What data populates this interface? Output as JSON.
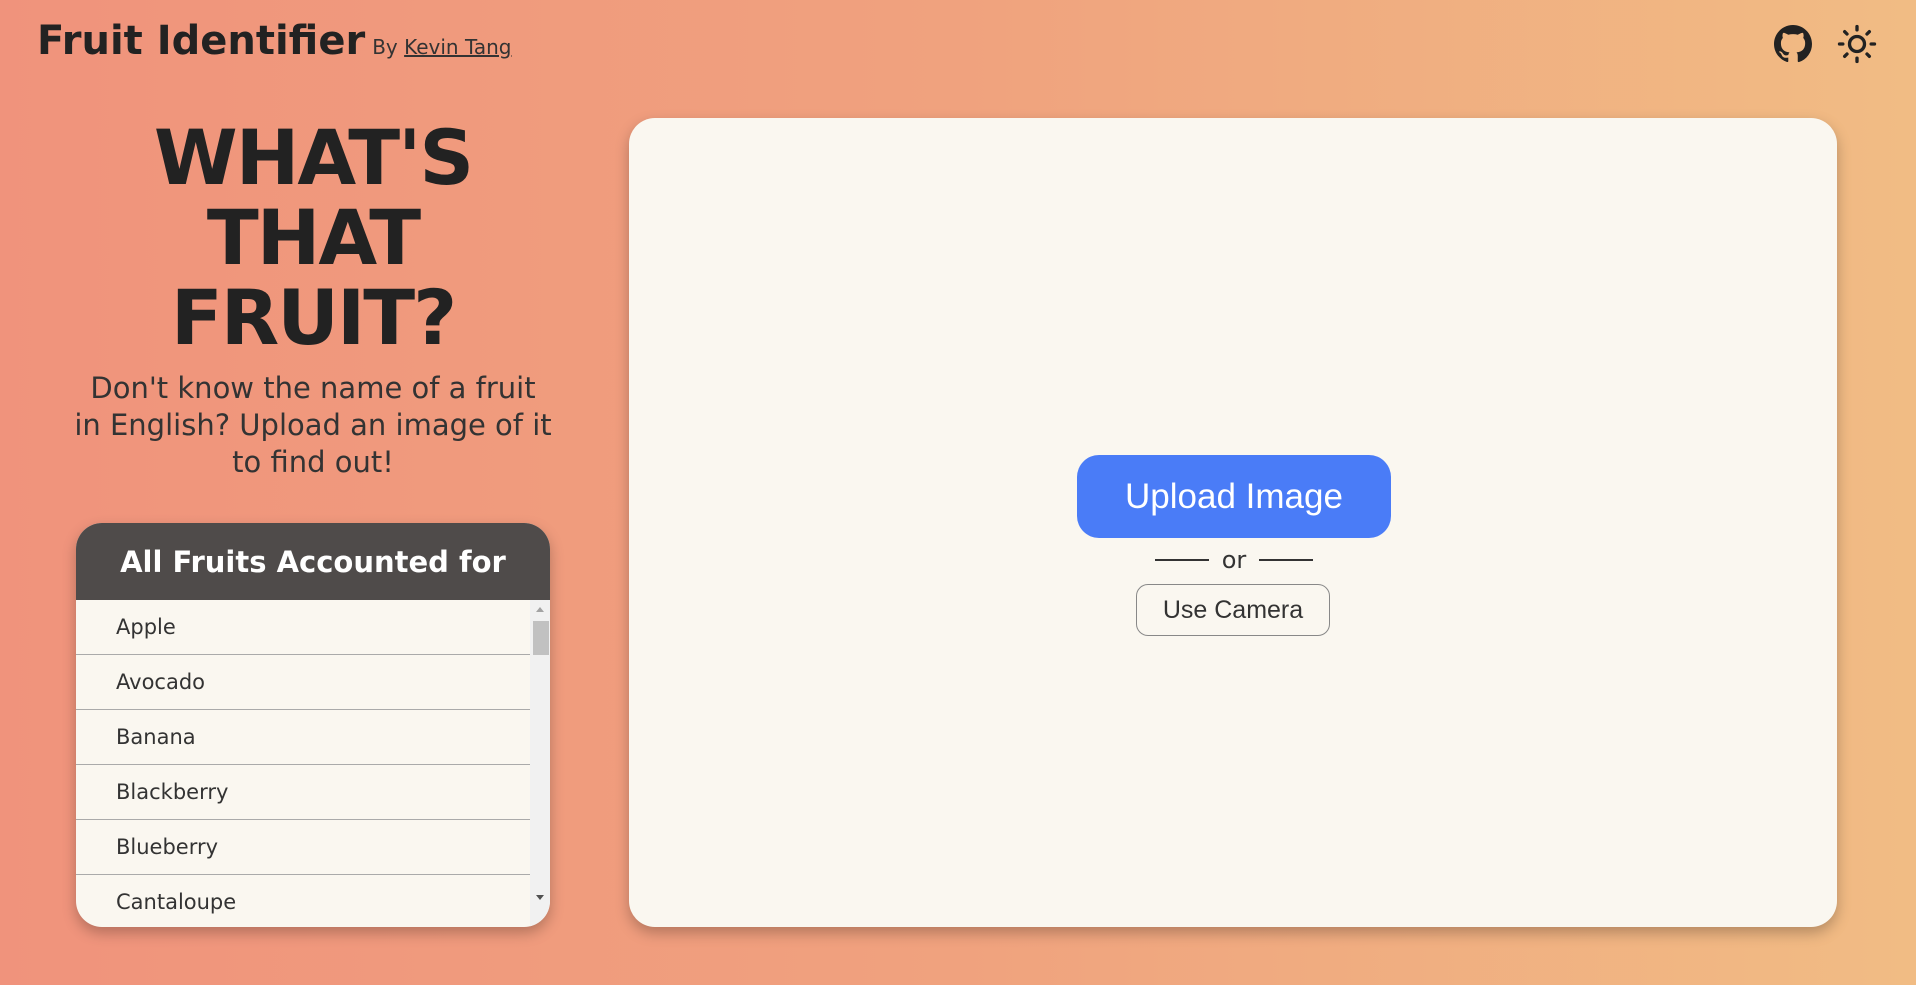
{
  "header": {
    "title": "Fruit Identifier",
    "by_label": "By",
    "author": "Kevin Tang",
    "icons": [
      "github-icon",
      "sun-icon"
    ]
  },
  "hero": {
    "line1": "WHAT'S",
    "line2": "THAT",
    "line3": "FRUIT?",
    "tagline": "Don't know the name of a fruit in English? Upload an image of it to find out!"
  },
  "fruit_list": {
    "heading": "All Fruits Accounted for",
    "items": [
      "Apple",
      "Avocado",
      "Banana",
      "Blackberry",
      "Blueberry",
      "Cantaloupe"
    ]
  },
  "upload": {
    "upload_label": "Upload Image",
    "or_label": "or",
    "camera_label": "Use Camera"
  },
  "colors": {
    "accent": "#4a7cf7",
    "card_bg": "#faf7f0",
    "list_header_bg": "#4f4b4a",
    "gradient_start": "#f0937c",
    "gradient_end": "#f1bc84"
  }
}
